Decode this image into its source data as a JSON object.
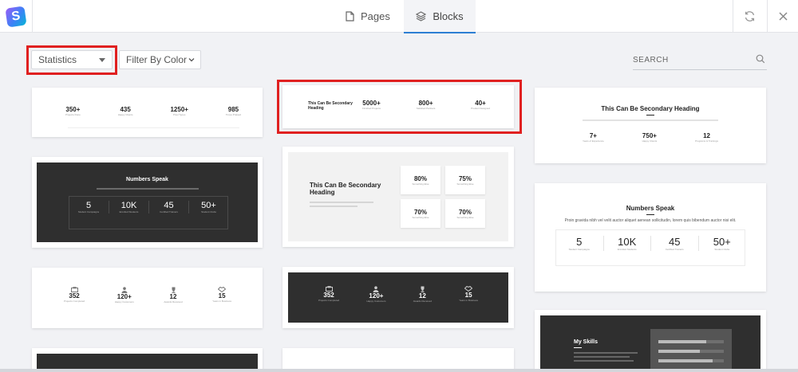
{
  "tabs": {
    "pages": "Pages",
    "blocks": "Blocks"
  },
  "filters": {
    "category": "Statistics",
    "color": "Filter By Color",
    "search_placeholder": "SEARCH"
  },
  "cards": {
    "c1": {
      "stats": [
        {
          "num": "350+",
          "label": "Projects Done"
        },
        {
          "num": "435",
          "label": "Happy Clients"
        },
        {
          "num": "1250+",
          "label": "Pixel Types"
        },
        {
          "num": "985",
          "label": "Times Praised"
        }
      ]
    },
    "c2": {
      "heading": "This Can Be Secondary Heading",
      "stats": [
        {
          "num": "5000+",
          "label": "Finished Projects"
        },
        {
          "num": "800+",
          "label": "Satisfied Partners"
        },
        {
          "num": "40+",
          "label": "Product Designed"
        }
      ]
    },
    "c3": {
      "heading": "This Can Be Secondary Heading",
      "stats": [
        {
          "num": "7+",
          "label": "Years of Experience"
        },
        {
          "num": "750+",
          "label": "Happy Clients"
        },
        {
          "num": "12",
          "label": "Programs & Trainings"
        }
      ]
    },
    "c4": {
      "title": "Numbers Speak",
      "stats": [
        {
          "num": "5",
          "label": "Student Campaigns"
        },
        {
          "num": "10K",
          "label": "Enrolled Students"
        },
        {
          "num": "45",
          "label": "Certified Trainers"
        },
        {
          "num": "50+",
          "label": "Student Clubs"
        }
      ]
    },
    "c5": {
      "heading": "This Can Be Secondary Heading",
      "cells": [
        {
          "num": "80%",
          "label": "Something Else"
        },
        {
          "num": "75%",
          "label": "Something Else"
        },
        {
          "num": "70%",
          "label": "Something Else"
        },
        {
          "num": "70%",
          "label": "Something Else"
        }
      ]
    },
    "c6": {
      "title": "Numbers Speak",
      "subtitle": "Proin gravida nibh vel velit auctor aliquet aenean sollicitudin, lorem quis bibendum auctor nisi elit.",
      "stats": [
        {
          "num": "5",
          "label": "Student Campaigns"
        },
        {
          "num": "10K",
          "label": "Enrolled Students"
        },
        {
          "num": "45",
          "label": "Certified Trainers"
        },
        {
          "num": "50+",
          "label": "Student Clubs"
        }
      ]
    },
    "c7": {
      "stats": [
        {
          "num": "352",
          "label": "Projects Completed"
        },
        {
          "num": "120+",
          "label": "Happy Customers"
        },
        {
          "num": "12",
          "label": "Awards Received"
        },
        {
          "num": "15",
          "label": "Years in Business"
        }
      ]
    },
    "c8": {
      "stats": [
        {
          "num": "352",
          "label": "Projects Completed"
        },
        {
          "num": "120+",
          "label": "Happy Customers"
        },
        {
          "num": "12",
          "label": "Awards Received"
        },
        {
          "num": "15",
          "label": "Years in Business"
        }
      ]
    },
    "c9": {
      "title": "My Skills"
    }
  },
  "colors": {
    "accent": "#2d7fd3",
    "highlight": "#e02020",
    "dark": "#2f2f2f"
  }
}
